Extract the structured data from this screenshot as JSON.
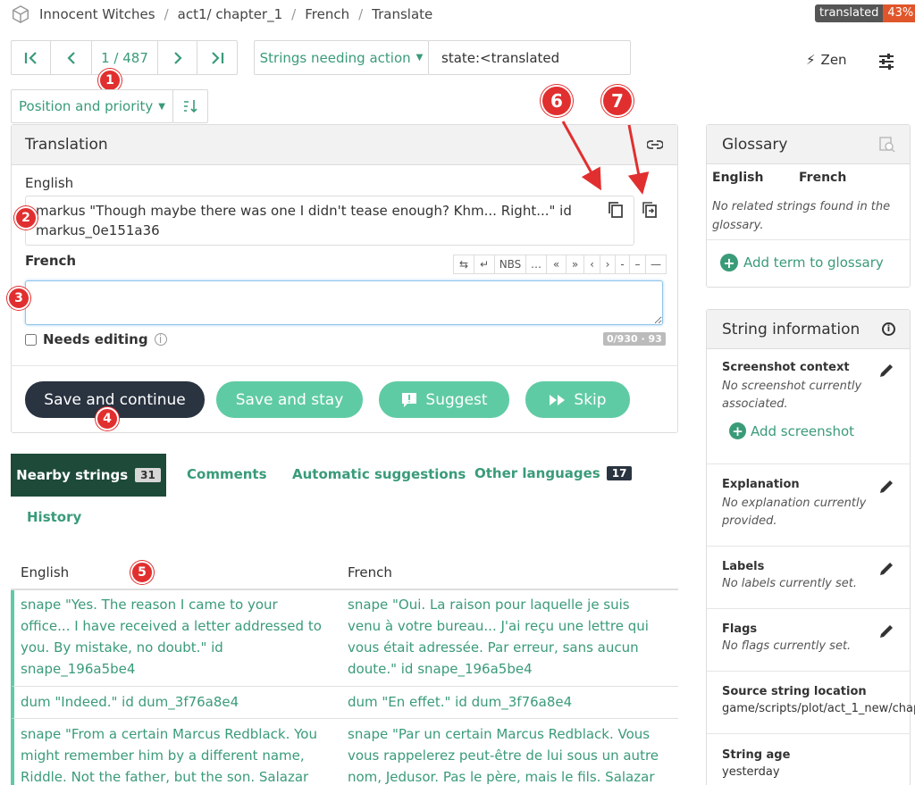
{
  "breadcrumb": {
    "project": "Innocent Witches",
    "component": "act1/ chapter_1",
    "language": "French",
    "page": "Translate"
  },
  "badge": {
    "label": "translated",
    "percent": "43%"
  },
  "nav": {
    "counter": "1 / 487",
    "filter_label": "Strings needing action",
    "query": "state:<translated",
    "zen": "Zen"
  },
  "sort": {
    "label": "Position and priority"
  },
  "translation": {
    "title": "Translation",
    "source_lang": "English",
    "source_text": "markus \"Though maybe there was one I didn't tease enough? Khm... Right...\" id markus_0e151a36",
    "target_lang": "French",
    "target_value": "",
    "toolbar": [
      "⇆",
      "↵",
      "NBS",
      "…",
      "«",
      "»",
      "‹",
      "›",
      "-",
      "–",
      "—"
    ],
    "needs_editing": "Needs editing",
    "counter": "0/930 · 93",
    "buttons": {
      "save_continue": "Save and continue",
      "save_stay": "Save and stay",
      "suggest": "Suggest",
      "skip": "Skip"
    }
  },
  "tabs": [
    {
      "label": "Nearby strings",
      "count": "31"
    },
    {
      "label": "Comments"
    },
    {
      "label": "Automatic suggestions"
    },
    {
      "label": "Other languages",
      "count": "17"
    },
    {
      "label": "History"
    }
  ],
  "table": {
    "headers": [
      "English",
      "French"
    ],
    "rows": [
      {
        "en": "snape \"Yes. The reason I came to your office... I have received a letter addressed to you. By mistake, no doubt.\" id snape_196a5be4",
        "fr": "snape \"Oui. La raison pour laquelle je suis venu à votre bureau... J'ai reçu une lettre qui vous était adressée. Par erreur, sans aucun doute.\" id snape_196a5be4"
      },
      {
        "en": "dum \"Indeed.\" id dum_3f76a8e4",
        "fr": "dum \"En effet.\" id dum_3f76a8e4"
      },
      {
        "en": "snape \"From a certain Marcus Redblack. You might remember him by a different name, Riddle. Not the father, but the son. Salazar Riddle.\" id",
        "fr": "snape \"Par un certain Marcus Redblack. Vous vous rappelerez peut-être de lui sous un autre nom, Jedusor. Pas le père, mais le fils. Salazar Jedusor.\""
      }
    ]
  },
  "glossary": {
    "title": "Glossary",
    "col1": "English",
    "col2": "French",
    "empty": "No related strings found in the glossary.",
    "add": "Add term to glossary"
  },
  "info": {
    "title": "String information",
    "sections": [
      {
        "title": "Screenshot context",
        "text": "No screenshot currently associated.",
        "action": "Add screenshot"
      },
      {
        "title": "Explanation",
        "text": "No explanation currently provided."
      },
      {
        "title": "Labels",
        "text": "No labels currently set."
      },
      {
        "title": "Flags",
        "text": "No flags currently set."
      },
      {
        "title": "Source string location",
        "text": "game/scripts/plot/act_1_new/chap"
      },
      {
        "title": "String age",
        "text": "yesterday"
      }
    ]
  },
  "markers": [
    "1",
    "2",
    "3",
    "4",
    "5",
    "6",
    "7"
  ],
  "colors": {
    "accent": "#3a9b78",
    "button_green": "#5fcba4",
    "dark_button": "#2a3340",
    "marker": "#e12f2f",
    "badge_dark": "#555555",
    "badge_orange": "#e0562a"
  }
}
